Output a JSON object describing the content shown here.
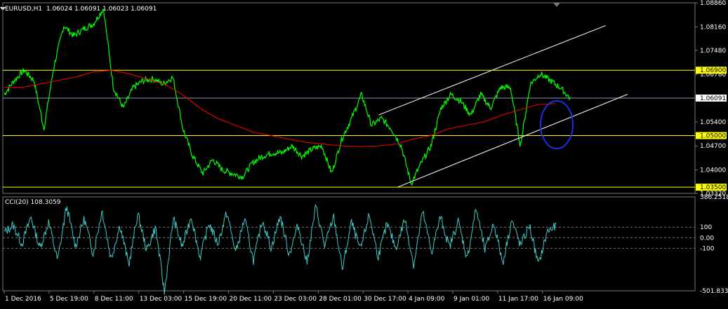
{
  "header": {
    "symbol": "EURUSD,H1",
    "ohlc": "1.06024 1.06091 1.06023 1.06091",
    "indicator": "CCI(20) 108.3059"
  },
  "colors": {
    "background": "#000000",
    "price": "#00ff00",
    "ma": "#ff0000",
    "cci": "#40c8c8",
    "levels": "#ffff00",
    "channel": "#ffffff",
    "bid_line": "#8899bb",
    "highlight_ellipse": "#1a2fe0",
    "grid": "#777777"
  },
  "chart_data": [
    {
      "type": "line",
      "title": "EURUSD,H1",
      "series": [
        {
          "name": "EURUSD,H1",
          "values": [
            1.062,
            1.066,
            1.069,
            1.066,
            1.052,
            1.07,
            1.082,
            1.079,
            1.081,
            1.0825,
            1.087,
            1.064,
            1.058,
            1.064,
            1.066,
            1.0665,
            1.065,
            1.067,
            1.052,
            1.044,
            1.039,
            1.043,
            1.04,
            1.039,
            1.038,
            1.042,
            1.044,
            1.045,
            1.045,
            1.047,
            1.044,
            1.046,
            1.047,
            1.039,
            1.049,
            1.055,
            1.062,
            1.053,
            1.055,
            1.052,
            1.047,
            1.036,
            1.042,
            1.047,
            1.058,
            1.062,
            1.06,
            1.056,
            1.062,
            1.058,
            1.064,
            1.064,
            1.047,
            1.065,
            1.068,
            1.066,
            1.064,
            1.0609
          ]
        },
        {
          "name": "",
          "values": [
            1.064,
            1.064,
            1.065,
            1.066,
            1.067,
            1.0685,
            1.069,
            1.068,
            1.0665,
            1.065,
            1.062,
            1.058,
            1.055,
            1.053,
            1.051,
            1.05,
            1.049,
            1.048,
            1.0475,
            1.047,
            1.0468,
            1.047,
            1.0475,
            1.049,
            1.05,
            1.052,
            1.053,
            1.054,
            1.056,
            1.0575,
            1.059,
            1.0593
          ]
        }
      ],
      "y_ticks": [
        "1.08860",
        "1.08160",
        "1.07480",
        "1.06780",
        "1.05400",
        "1.04700",
        "1.04000",
        "1.03320"
      ],
      "ylim": [
        1.0332,
        1.0886
      ],
      "current_price": "1.06091",
      "levels": [
        {
          "label": "1.06900",
          "value": 1.069
        },
        {
          "label": "1.05000",
          "value": 1.05
        },
        {
          "label": "1.03500",
          "value": 1.035
        }
      ],
      "channel_lines": [
        {
          "x": [
            0.52,
            0.832
          ],
          "y": [
            1.056,
            1.082
          ]
        },
        {
          "x": [
            0.546,
            0.862
          ],
          "y": [
            1.035,
            1.062
          ]
        }
      ],
      "x_ticks": [
        "1 Dec 2016",
        "5 Dec 19:00",
        "8 Dec 11:00",
        "13 Dec 03:00",
        "15 Dec 19:00",
        "20 Dec 11:00",
        "23 Dec 03:00",
        "28 Dec 01:00",
        "30 Dec 17:00",
        "4 Jan 09:00",
        "9 Jan 01:00",
        "11 Jan 17:00",
        "16 Jan 09:00"
      ]
    },
    {
      "type": "line",
      "title": "CCI(20) 108.3059",
      "series": [
        {
          "name": "CCI(20)",
          "values": [
            50,
            120,
            -60,
            200,
            -100,
            150,
            -220,
            300,
            -80,
            180,
            -150,
            260,
            -200,
            120,
            -260,
            230,
            -120,
            100,
            -520,
            190,
            -90,
            210,
            -190,
            140,
            -60,
            240,
            -140,
            180,
            -220,
            170,
            -100,
            210,
            -160,
            120,
            -240,
            300,
            -80,
            200,
            -300,
            150,
            -120,
            220,
            -180,
            130,
            -100,
            180,
            -260,
            250,
            -140,
            200,
            -90,
            160,
            -200,
            280,
            -120,
            140,
            -240,
            170,
            -80,
            120,
            -260,
            60,
            108
          ]
        }
      ],
      "y_ticks": [
        "386.2518",
        "100",
        "0.00",
        "-100",
        "-501.8336"
      ],
      "levels": [
        100,
        0,
        -100
      ],
      "ylim": [
        -501.8336,
        386.2518
      ],
      "current_value": 108.3059
    }
  ]
}
